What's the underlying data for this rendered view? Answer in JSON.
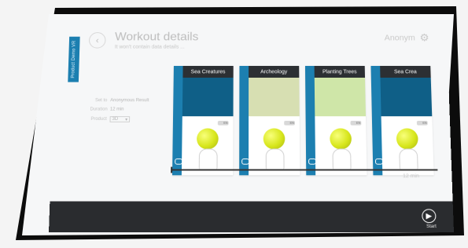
{
  "side_tab": {
    "label": "Product Demo VR"
  },
  "header": {
    "title": "Workout details",
    "subtitle": "It won't contain data details ..."
  },
  "user": {
    "name": "Anonym"
  },
  "info": {
    "rows": [
      {
        "k": "Set to",
        "v": "Anonymous Result"
      },
      {
        "k": "Duration",
        "v": "12 min"
      },
      {
        "k": "Product",
        "v": "3D"
      }
    ],
    "select_value": "3D"
  },
  "cards": [
    {
      "title": "Sea Creatures",
      "badge": "EN"
    },
    {
      "title": "Archeology",
      "badge": "EN"
    },
    {
      "title": "Planting Trees",
      "badge": "EN"
    },
    {
      "title": "Sea Crea",
      "badge": "EN"
    }
  ],
  "timeline": {
    "duration_label": "12 min"
  },
  "bottom_bar": {
    "start_label": "Start"
  },
  "icons": {
    "back": "back-icon",
    "gear": "gear-icon",
    "start": "play-icon",
    "vr": "vr-headset-icon"
  },
  "colors": {
    "accent": "#1c7fb0",
    "card_header": "#2c2f33",
    "bottom_bar": "#2a2c2f"
  }
}
